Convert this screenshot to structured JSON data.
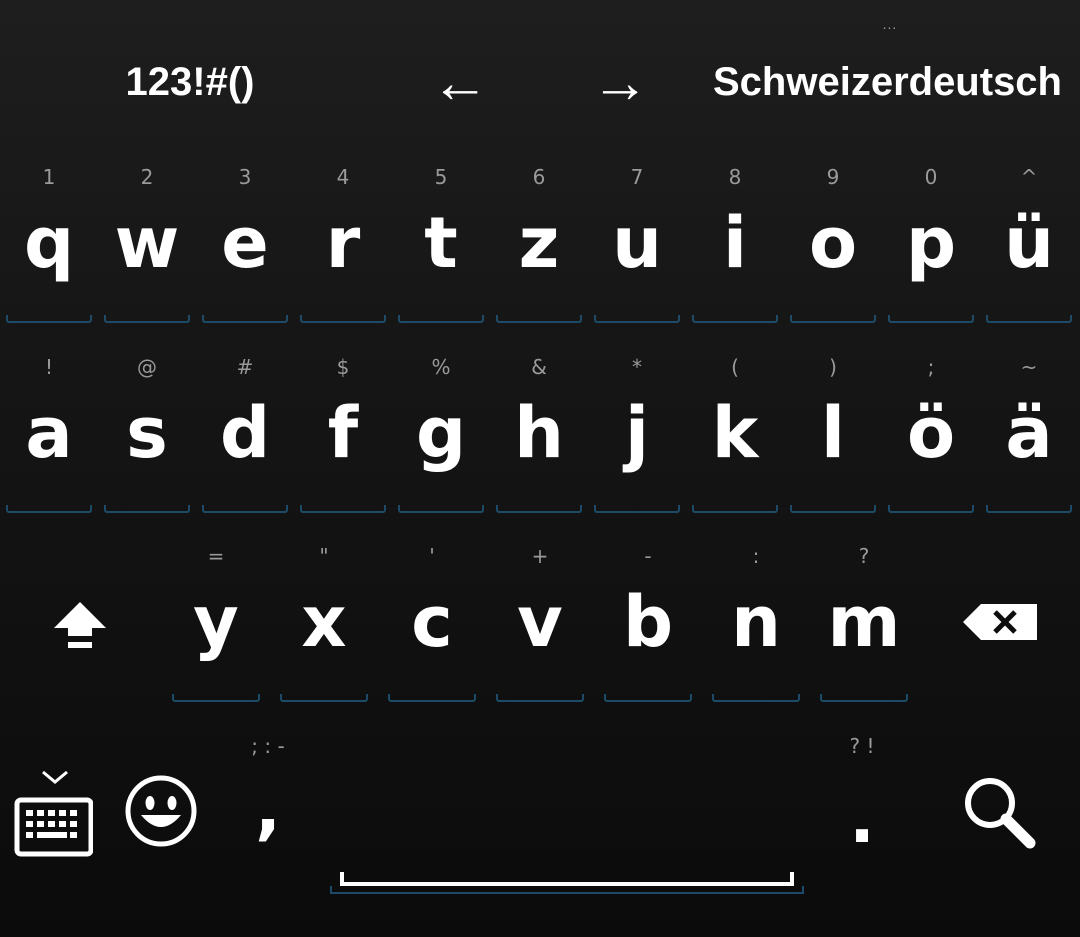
{
  "top_bar": {
    "symbols_label": "123!#()",
    "left_arrow": "←",
    "right_arrow": "→",
    "language_label": "Schweizerdeutsch",
    "language_more": "..."
  },
  "rows": [
    [
      {
        "hint": "1",
        "label": "q"
      },
      {
        "hint": "2",
        "label": "w"
      },
      {
        "hint": "3",
        "label": "e"
      },
      {
        "hint": "4",
        "label": "r"
      },
      {
        "hint": "5",
        "label": "t"
      },
      {
        "hint": "6",
        "label": "z"
      },
      {
        "hint": "7",
        "label": "u"
      },
      {
        "hint": "8",
        "label": "i"
      },
      {
        "hint": "9",
        "label": "o"
      },
      {
        "hint": "0",
        "label": "p"
      },
      {
        "hint": "^",
        "label": "ü"
      }
    ],
    [
      {
        "hint": "!",
        "label": "a"
      },
      {
        "hint": "@",
        "label": "s"
      },
      {
        "hint": "#",
        "label": "d"
      },
      {
        "hint": "$",
        "label": "f"
      },
      {
        "hint": "%",
        "label": "g"
      },
      {
        "hint": "&",
        "label": "h"
      },
      {
        "hint": "*",
        "label": "j"
      },
      {
        "hint": "(",
        "label": "k"
      },
      {
        "hint": ")",
        "label": "l"
      },
      {
        "hint": ";",
        "label": "ö"
      },
      {
        "hint": "~",
        "label": "ä"
      }
    ],
    [
      {
        "hint": "=",
        "label": "y"
      },
      {
        "hint": "\"",
        "label": "x"
      },
      {
        "hint": "'",
        "label": "c"
      },
      {
        "hint": "+",
        "label": "v"
      },
      {
        "hint": "-",
        "label": "b"
      },
      {
        "hint": ":",
        "label": "n"
      },
      {
        "hint": "?",
        "label": "m"
      }
    ]
  ],
  "bottom_row": {
    "comma_hint": "; : -",
    "comma_label": ",",
    "period_hint": "? !",
    "period_label": "."
  },
  "icons": {
    "shift": "shift-arrow-icon",
    "backspace": "backspace-icon",
    "keyboard_hide": "keyboard-hide-icon",
    "emoji": "emoji-smiley-icon",
    "search": "search-icon"
  },
  "colors": {
    "background": "#111111",
    "key_text": "#ffffff",
    "hint_text": "#9a9a9a",
    "key_underline": "#1d4a66"
  }
}
